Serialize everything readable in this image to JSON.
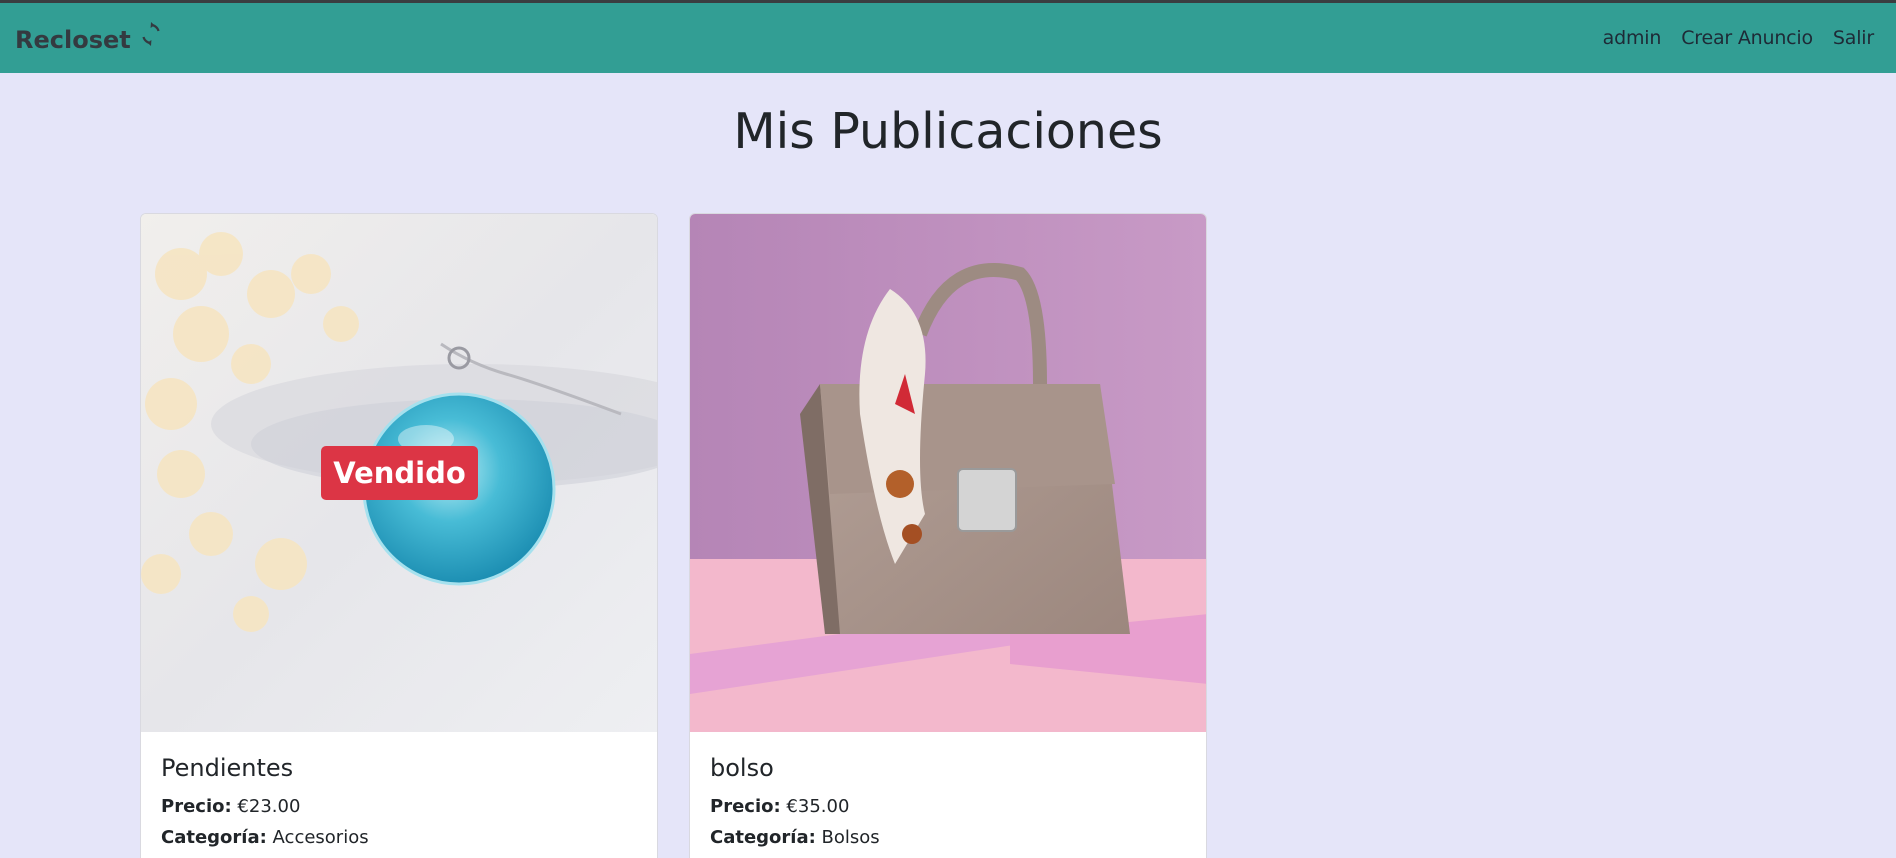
{
  "navbar": {
    "brand": "Recloset",
    "brand_icon": "sync-icon",
    "links": [
      "admin",
      "Crear Anuncio",
      "Salir"
    ]
  },
  "main": {
    "title": "Mis Publicaciones"
  },
  "cards": [
    {
      "title": "Pendientes",
      "price_label": "Precio:",
      "price": "€23.00",
      "category_label": "Categoría:",
      "category": "Accesorios",
      "badge": "Vendido"
    },
    {
      "title": "bolso",
      "price_label": "Precio:",
      "price": "€35.00",
      "category_label": "Categoría:",
      "category": "Bolsos"
    }
  ],
  "colors": {
    "navbar": "#329e94",
    "background": "#e5e5f9",
    "badge": "#dc3545"
  }
}
